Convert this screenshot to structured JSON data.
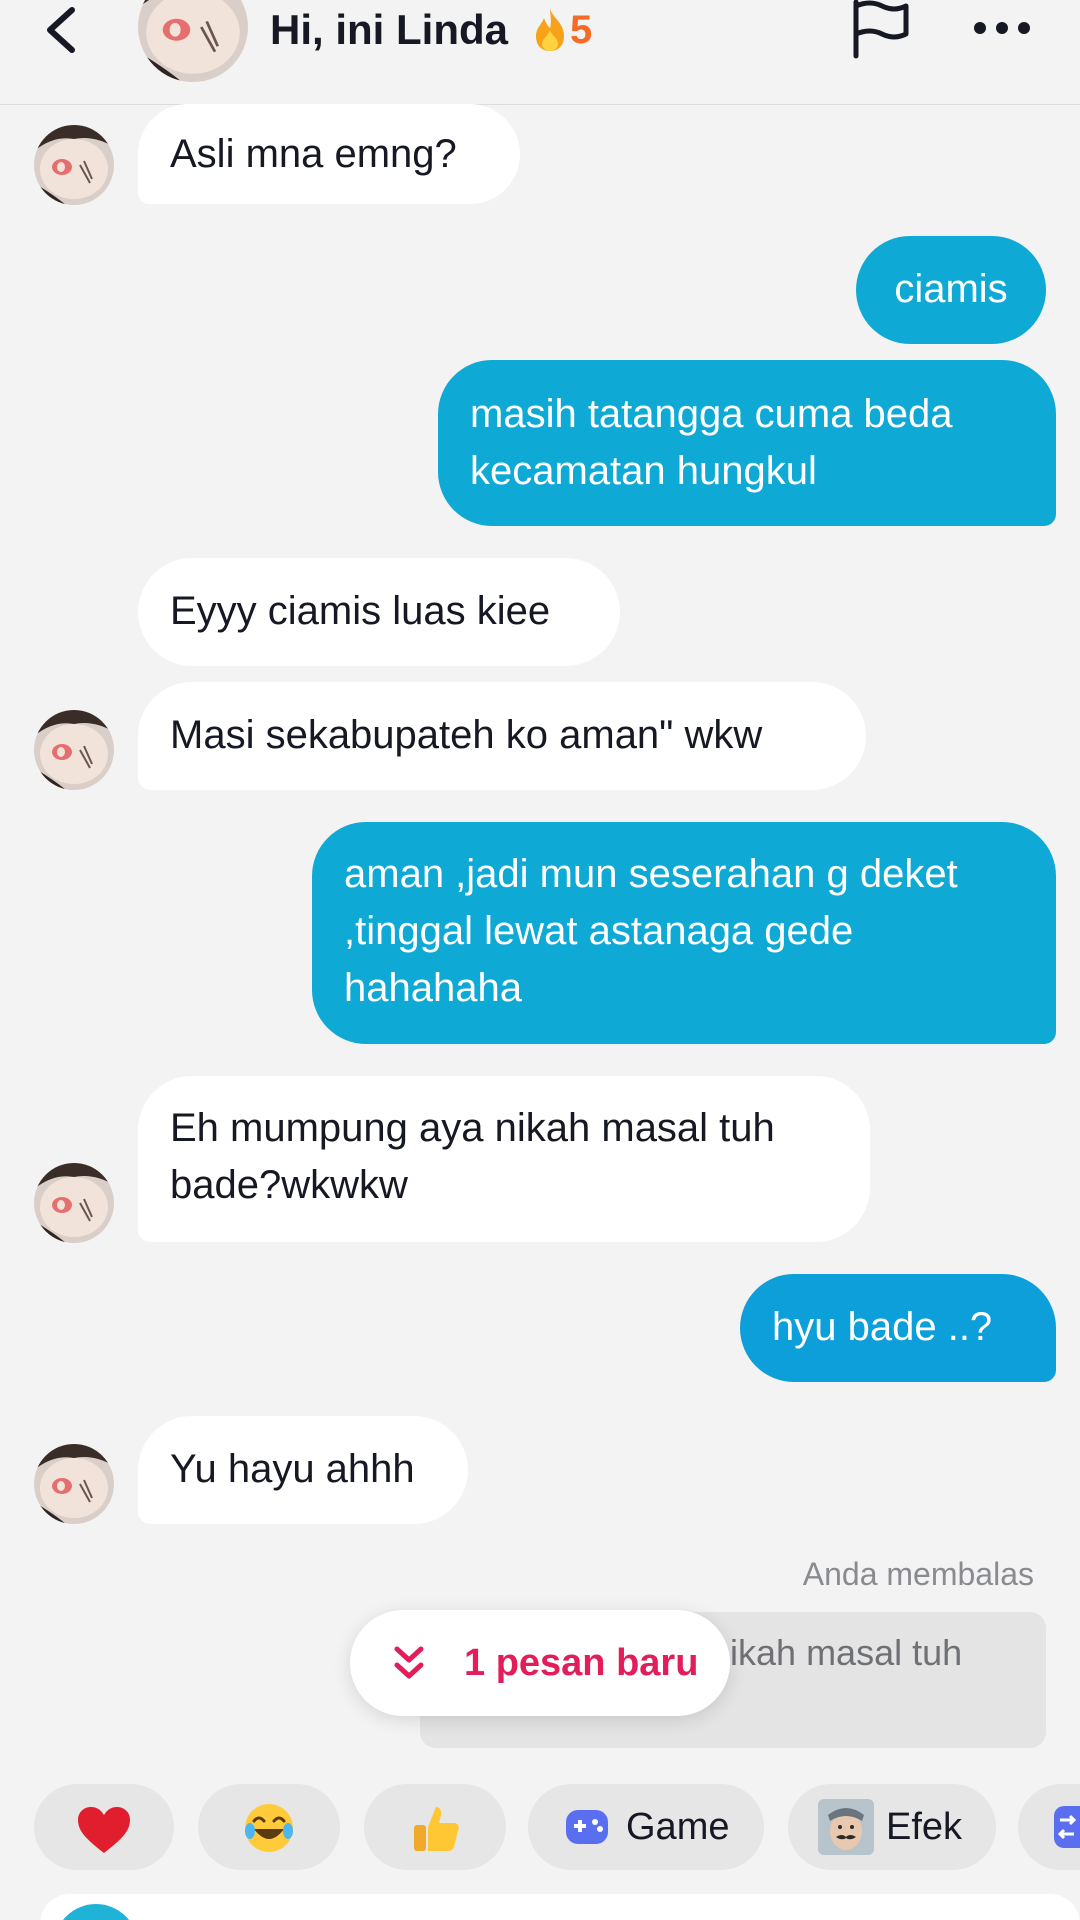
{
  "header": {
    "title": "Hi, ini Linda",
    "streak_count": "5",
    "icons": [
      "back-arrow-icon",
      "flame-icon",
      "flag-icon",
      "more-icon"
    ]
  },
  "messages": [
    {
      "from": "them",
      "text": "Asli mna emng?"
    },
    {
      "from": "me",
      "text": "ciamis"
    },
    {
      "from": "me",
      "lines": [
        "masih tatangga cuma beda",
        "kecamatan hungkul"
      ]
    },
    {
      "from": "them",
      "text": "Eyyy ciamis luas kiee"
    },
    {
      "from": "them",
      "text": "Masi sekabupateh ko aman\" wkw"
    },
    {
      "from": "me",
      "lines": [
        "aman ,jadi mun seserahan g deket",
        ",tinggal lewat astanaga gede",
        "hahahaha"
      ]
    },
    {
      "from": "them",
      "lines": [
        "Eh mumpung aya nikah masal tuh",
        "bade?wkwkw"
      ]
    },
    {
      "from": "me",
      "text": "hyu bade ..?"
    },
    {
      "from": "them",
      "text": "Yu hayu ahhh"
    }
  ],
  "reply": {
    "label": "Anda membalas",
    "quoted_text": "nikah masal tuh"
  },
  "new_message_pill": {
    "label": "1 pesan baru"
  },
  "quick_bar": [
    {
      "icon": "heart-icon",
      "label": ""
    },
    {
      "icon": "laughing-emoji-icon",
      "label": ""
    },
    {
      "icon": "thumbs-up-icon",
      "label": ""
    },
    {
      "icon": "gamepad-icon",
      "label": "Game"
    },
    {
      "icon": "face-effect-icon",
      "label": "Efek"
    }
  ],
  "colors": {
    "outgoing_bubble": "#0fa9d6",
    "incoming_bubble": "#ffffff",
    "background": "#f3f3f3",
    "new_message_text": "#e31c5a",
    "streak": "#f56a24"
  }
}
